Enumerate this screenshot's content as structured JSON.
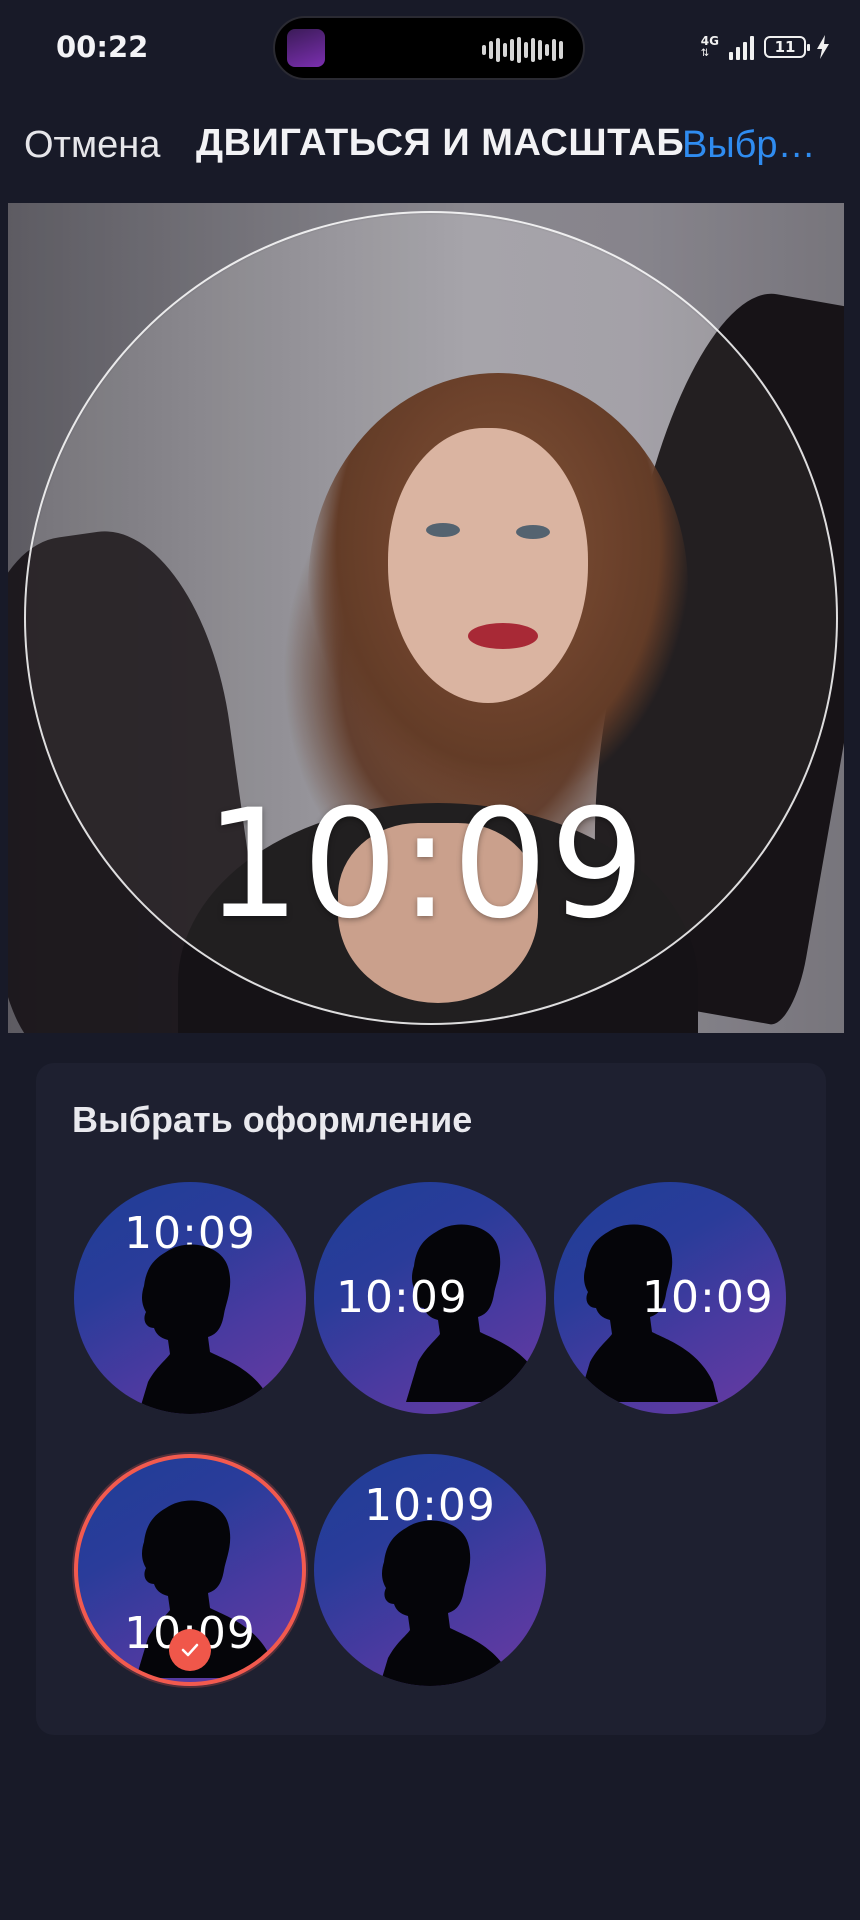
{
  "status_bar": {
    "time": "00:22",
    "network": "4G",
    "battery": "11"
  },
  "header": {
    "cancel_label": "Отмена",
    "title": "ДВИГАТЬСЯ И МАСШТАБ",
    "select_label": "Выбрать"
  },
  "editor": {
    "clock_time": "10:09"
  },
  "style_panel": {
    "title": "Выбрать оформление",
    "options": [
      {
        "time": "10:09",
        "selected": false
      },
      {
        "time": "10:09",
        "selected": false
      },
      {
        "time": "10:09",
        "selected": false
      },
      {
        "time": "10:09",
        "selected": true
      },
      {
        "time": "10:09",
        "selected": false
      }
    ]
  },
  "colors": {
    "background": "#181a28",
    "panel": "#1e2030",
    "accent_blue": "#2f8cf0",
    "selected_red": "#f25a4e"
  }
}
